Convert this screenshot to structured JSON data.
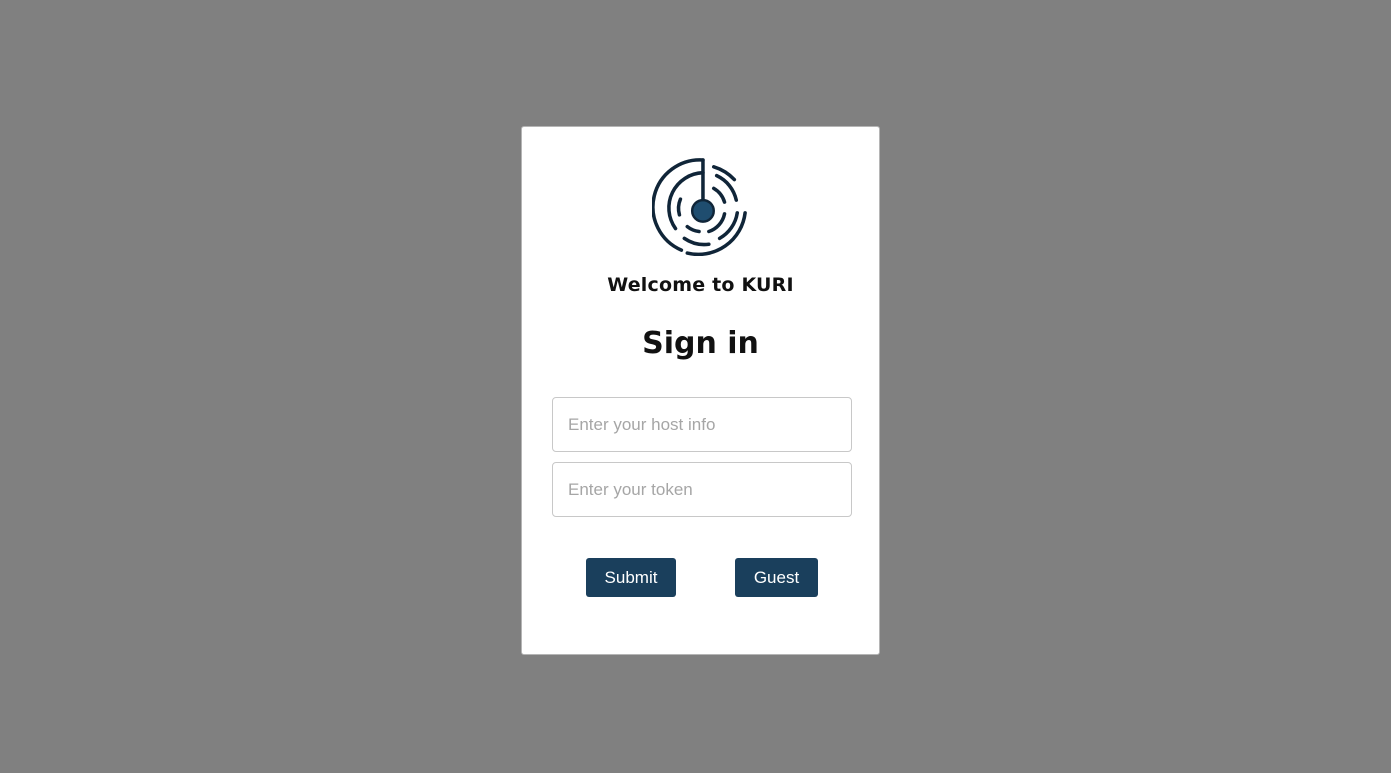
{
  "login": {
    "logo_icon": "radar-spiral-logo-icon",
    "welcome": "Welcome to KURI",
    "heading": "Sign in",
    "host_placeholder": "Enter your host info",
    "host_value": "",
    "token_placeholder": "Enter your token",
    "token_value": "",
    "submit_label": "Submit",
    "guest_label": "Guest"
  },
  "colors": {
    "background": "#808080",
    "card": "#ffffff",
    "accent": "#1a3f5c",
    "logo_stroke": "#102538"
  }
}
